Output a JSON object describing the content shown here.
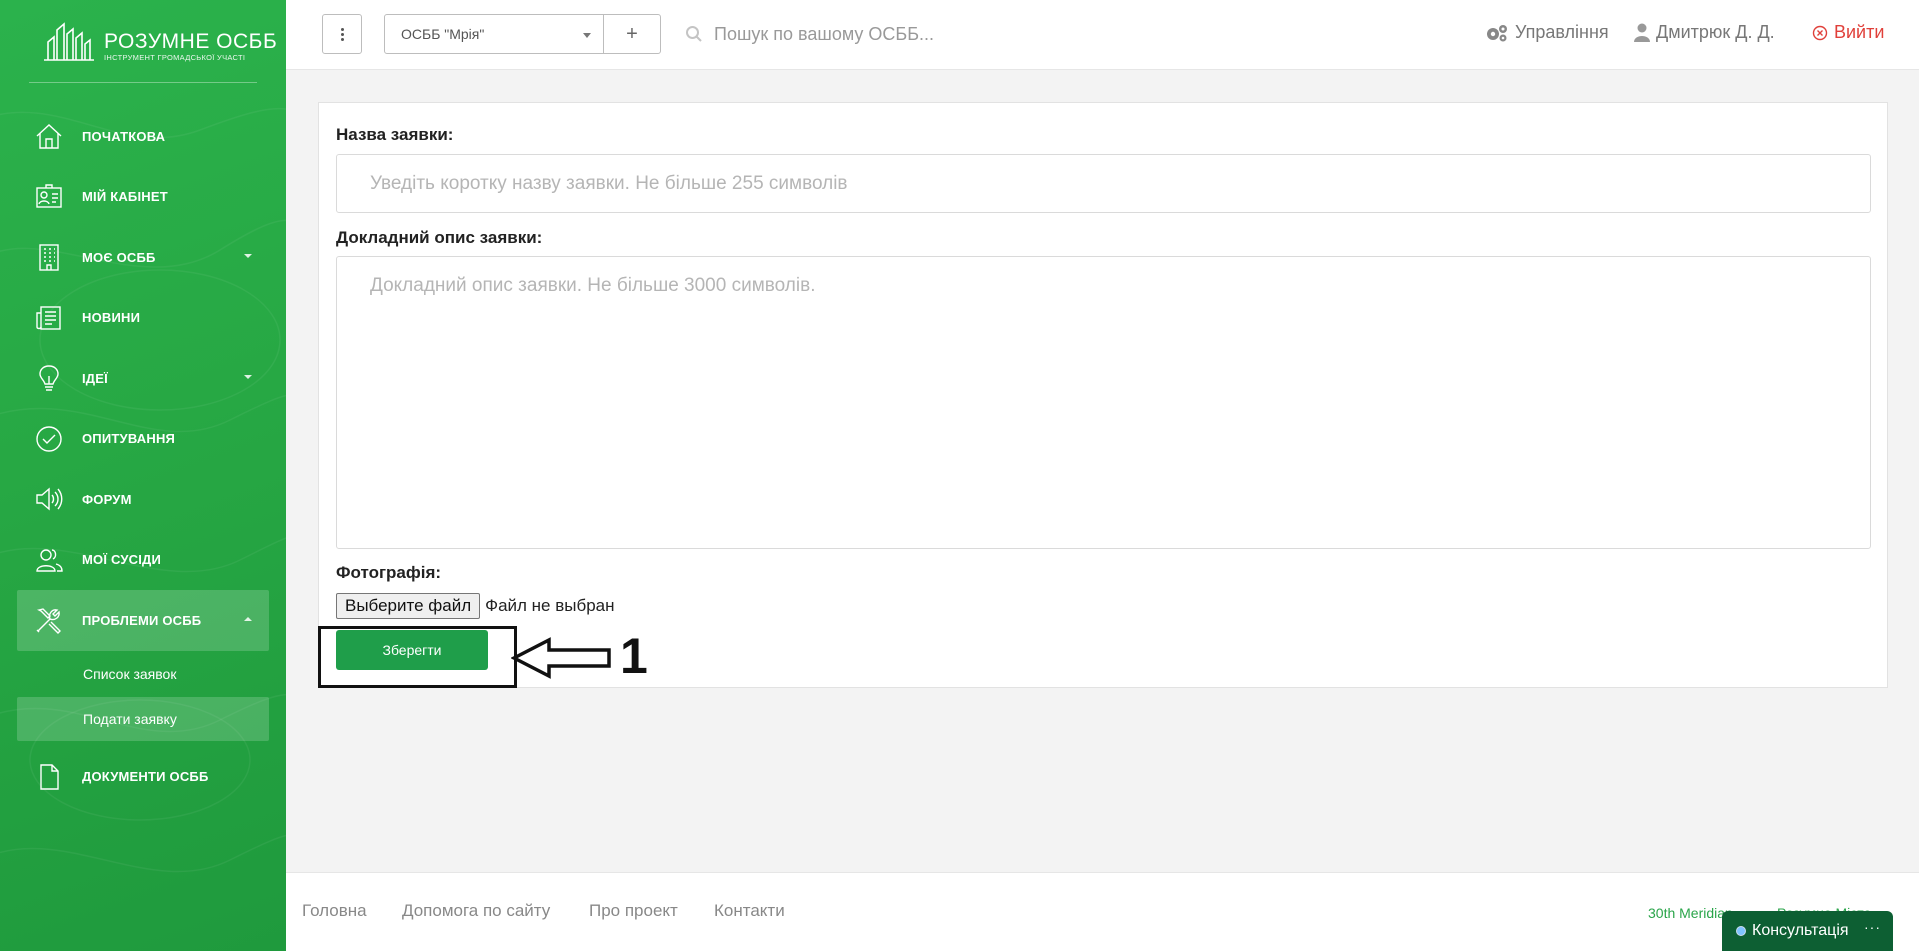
{
  "brand": {
    "title": "РОЗУМНЕ ОСББ",
    "subtitle": "ІНСТРУМЕНТ ГРОМАДСЬКОЇ УЧАСТІ"
  },
  "sidebar": {
    "items": [
      {
        "label": "ПОЧАТКОВА",
        "icon": "home-icon"
      },
      {
        "label": "МІЙ КАБІНЕТ",
        "icon": "id-card-icon"
      },
      {
        "label": "МОЄ ОСББ",
        "icon": "building-icon",
        "caret": "down"
      },
      {
        "label": "НОВИНИ",
        "icon": "newspaper-icon"
      },
      {
        "label": "ІДЕЇ",
        "icon": "lightbulb-icon",
        "caret": "down"
      },
      {
        "label": "ОПИТУВАННЯ",
        "icon": "check-circle-icon"
      },
      {
        "label": "ФОРУМ",
        "icon": "megaphone-icon"
      },
      {
        "label": "МОЇ СУСІДИ",
        "icon": "users-icon"
      },
      {
        "label": "ПРОБЛЕМИ ОСББ",
        "icon": "tools-icon",
        "caret": "up",
        "active": true
      },
      {
        "label": "ДОКУМЕНТИ ОСББ",
        "icon": "document-icon"
      }
    ],
    "subitems": [
      {
        "label": "Список заявок"
      },
      {
        "label": "Подати заявку",
        "active": true
      }
    ]
  },
  "header": {
    "org_selected": "ОСББ \"Мрія\"",
    "add_label": "+",
    "search_placeholder": "Пошук по вашому ОСББ...",
    "manage_label": "Управління",
    "user_label": "Дмитрюк Д. Д.",
    "logout_label": "Вийти"
  },
  "form": {
    "title_label": "Назва заявки:",
    "title_placeholder": "Уведіть коротку назву заявки. Не більше 255 символів",
    "desc_label": "Докладний опис заявки:",
    "desc_placeholder": "Докладний опис заявки. Не більше 3000 символів.",
    "photo_label": "Фотографія:",
    "file_button": "Выберите файл",
    "file_status": "Файл не выбран",
    "save_label": "Зберегти"
  },
  "annotation": {
    "step": "1"
  },
  "footer": {
    "links": [
      "Головна",
      "Допомога по сайту",
      "Про проект",
      "Контакти"
    ],
    "right_links": [
      "30th Meridian",
      "Розумне Місто"
    ],
    "consult_label": "Консультація"
  },
  "colors": {
    "accent": "#27a844",
    "save": "#1f9e4a",
    "logout": "#e0403a",
    "chat": "#0d5f33"
  }
}
